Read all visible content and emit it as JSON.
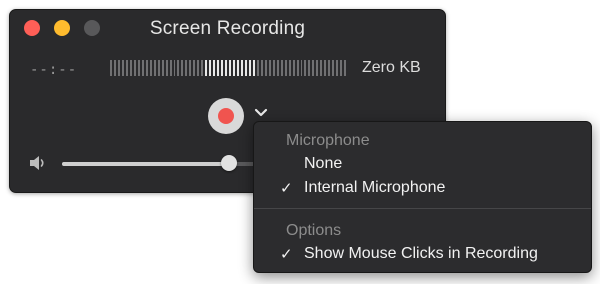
{
  "window": {
    "title": "Screen Recording",
    "elapsed_time": "--:--",
    "file_size": "Zero KB",
    "record_button_icon": "record-icon",
    "options_icon": "chevron-down-icon",
    "volume_icon": "speaker-icon",
    "volume_level": 0.85,
    "audio_level_meter_icon": "level-meter"
  },
  "menu": {
    "microphone_header": "Microphone",
    "microphone_items": [
      {
        "label": "None",
        "checked": false
      },
      {
        "label": "Internal Microphone",
        "checked": true
      }
    ],
    "options_header": "Options",
    "options_items": [
      {
        "label": "Show Mouse Clicks in Recording",
        "checked": true
      }
    ],
    "check_glyph": "✓"
  },
  "colors": {
    "close": "#fe5f57",
    "minimize": "#febb2e",
    "zoom_disabled": "#58585a",
    "record_dot": "#f0544f",
    "window_bg": "#2a2a2c",
    "menu_bg": "#2c2c2e"
  }
}
